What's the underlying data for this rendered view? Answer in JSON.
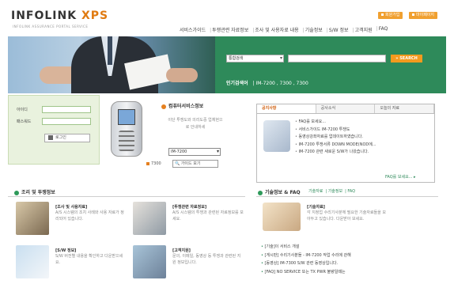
{
  "header": {
    "logo_main": "INFOLINK",
    "logo_accent": "XPS",
    "tagline": "INFOLINK ASSURANCE PORTAL SERVICE",
    "util_buttons": [
      "회원가입",
      "마이페이지"
    ],
    "nav": [
      "서비스가이드",
      "투쟁관련 자료정보",
      "조사 및 사용자료 내용",
      "기술정보",
      "S/W 정보",
      "고객지원",
      "FAQ"
    ]
  },
  "search": {
    "category": "통합검색",
    "query": "",
    "button": "SEARCH",
    "popular_label": "인기검색어",
    "popular_terms": "IM-7200 , 7300 , 7300"
  },
  "login": {
    "id_label": "아이디",
    "pw_label": "패스워드",
    "button": "로그인"
  },
  "promo": {
    "title": "컴퓨터서비스정보",
    "desc": "이단 투쟁도와 의리도중 업체현으로 안내하세",
    "model_select": "IM-7200",
    "model_code": "7300",
    "guide_button": "가이드 보기"
  },
  "news": {
    "tabs": [
      "공지사항",
      "공사소식",
      "오늘의 자료"
    ],
    "items": [
      "FAQ를 보세요...",
      "서비스가이드 IM-7200 투쟁도",
      "동영상강좌자료를 업데이트하였습니다.",
      "IM-7200 투쟁서류 DOWN MODE(NOD에...",
      "IM-7200 관련 새로운 S/W가 나왔습니다."
    ],
    "more": "FAQ를 보세요..."
  },
  "left_section": {
    "title": "조리 및 투쟁정보",
    "cards": [
      {
        "title": "[조사 및 사용자료]",
        "desc": "A/S 시스템의 조치 사례와 사용 자료가 정리되어 있습니다."
      },
      {
        "title": "[투쟁관련 자료정보]",
        "desc": "A/S 시스템의 투쟁과 관련된 자료정보를 보세요."
      },
      {
        "title": "[S/W 정보]",
        "desc": "S/W 버전별 내용을 확인하고 다운받으세요."
      },
      {
        "title": "[고객지원]",
        "desc": "문의, 이메일, 동영상 등 투쟁과 관련된 지원 정보입니다."
      }
    ]
  },
  "right_section": {
    "title": "기술정보 & FAQ",
    "tabs": [
      "기술자료",
      "기술정보",
      "FAQ"
    ],
    "feature_title": "[기술자료]",
    "feature_desc": "각 지정업 수리기사분께 필요한 기술자료들을 모아두고 있습니다. 다운받아 보세요.",
    "list": [
      "[기술]이 서비스 개설",
      "[게시판] 수리기사분들 - IM-7200 작업 수리에 관해",
      "[동영상] IM-7300 S/W 관련 동영상입니다.",
      "[FAQ] NO SERVICE 또는 TX PWR 불량일때는"
    ]
  }
}
